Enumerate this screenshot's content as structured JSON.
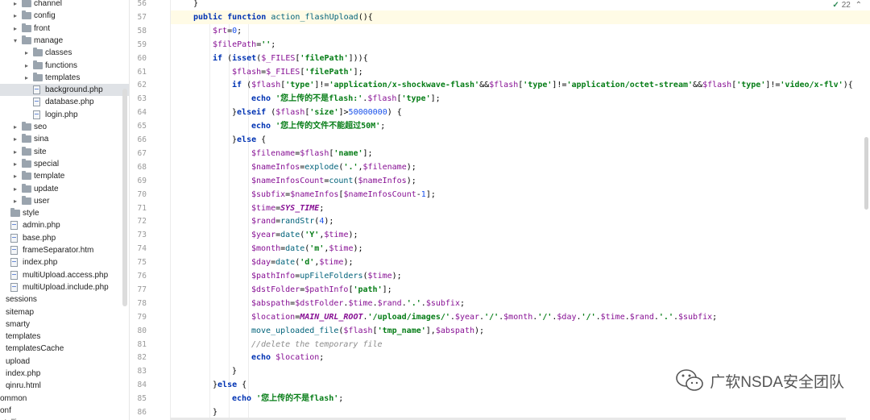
{
  "tree": {
    "items": [
      {
        "label": "channel",
        "kind": "folder",
        "indent": 1,
        "arrow": "▸"
      },
      {
        "label": "config",
        "kind": "folder",
        "indent": 1,
        "arrow": "▸"
      },
      {
        "label": "front",
        "kind": "folder",
        "indent": 1,
        "arrow": "▸"
      },
      {
        "label": "manage",
        "kind": "folder",
        "indent": 1,
        "arrow": "▾"
      },
      {
        "label": "classes",
        "kind": "folder",
        "indent": 2,
        "arrow": "▸"
      },
      {
        "label": "functions",
        "kind": "folder",
        "indent": 2,
        "arrow": "▸"
      },
      {
        "label": "templates",
        "kind": "folder",
        "indent": 2,
        "arrow": "▸"
      },
      {
        "label": "background.php",
        "kind": "file",
        "indent": 2,
        "arrow": "",
        "selected": true
      },
      {
        "label": "database.php",
        "kind": "file",
        "indent": 2,
        "arrow": ""
      },
      {
        "label": "login.php",
        "kind": "file",
        "indent": 2,
        "arrow": ""
      },
      {
        "label": "seo",
        "kind": "folder",
        "indent": 1,
        "arrow": "▸"
      },
      {
        "label": "sina",
        "kind": "folder",
        "indent": 1,
        "arrow": "▸"
      },
      {
        "label": "site",
        "kind": "folder",
        "indent": 1,
        "arrow": "▸"
      },
      {
        "label": "special",
        "kind": "folder",
        "indent": 1,
        "arrow": "▸"
      },
      {
        "label": "template",
        "kind": "folder",
        "indent": 1,
        "arrow": "▸"
      },
      {
        "label": "update",
        "kind": "folder",
        "indent": 1,
        "arrow": "▸"
      },
      {
        "label": "user",
        "kind": "folder",
        "indent": 1,
        "arrow": "▸"
      },
      {
        "label": "style",
        "kind": "folder",
        "indent": 0,
        "arrow": ""
      },
      {
        "label": "admin.php",
        "kind": "file",
        "indent": 0,
        "arrow": ""
      },
      {
        "label": "base.php",
        "kind": "file",
        "indent": 0,
        "arrow": ""
      },
      {
        "label": "frameSeparator.htm",
        "kind": "file",
        "indent": 0,
        "arrow": ""
      },
      {
        "label": "index.php",
        "kind": "file",
        "indent": 0,
        "arrow": ""
      },
      {
        "label": "multiUpload.access.php",
        "kind": "file",
        "indent": 0,
        "arrow": ""
      },
      {
        "label": "multiUpload.include.php",
        "kind": "file",
        "indent": 0,
        "arrow": ""
      },
      {
        "label": "sessions",
        "kind": "text",
        "indent": -1,
        "arrow": ""
      },
      {
        "label": "sitemap",
        "kind": "text",
        "indent": -1,
        "arrow": ""
      },
      {
        "label": "smarty",
        "kind": "text",
        "indent": -1,
        "arrow": ""
      },
      {
        "label": "templates",
        "kind": "text",
        "indent": -1,
        "arrow": ""
      },
      {
        "label": "templatesCache",
        "kind": "text",
        "indent": -1,
        "arrow": ""
      },
      {
        "label": "upload",
        "kind": "text",
        "indent": -1,
        "arrow": ""
      },
      {
        "label": "index.php",
        "kind": "text",
        "indent": -1,
        "arrow": ""
      },
      {
        "label": "qinru.html",
        "kind": "text",
        "indent": -1,
        "arrow": ""
      },
      {
        "label": "ommon",
        "kind": "text",
        "indent": -2,
        "arrow": ""
      },
      {
        "label": "onf",
        "kind": "text",
        "indent": -2,
        "arrow": ""
      },
      {
        "label": "ntellig",
        "kind": "text",
        "indent": -2,
        "arrow": ""
      }
    ]
  },
  "editor": {
    "inspection_count": "22",
    "lines": [
      {
        "n": "56",
        "i": 0,
        "t": [
          [
            "p",
            "}"
          ]
        ]
      },
      {
        "n": "57",
        "i": 0,
        "t": [
          [
            "kw",
            "public function "
          ],
          [
            "fn",
            "action_flashUpload"
          ],
          [
            "p",
            "(){"
          ]
        ]
      },
      {
        "n": "58",
        "i": 1,
        "t": [
          [
            "var",
            "$rt"
          ],
          [
            "p",
            "="
          ],
          [
            "num",
            "0"
          ],
          [
            "p",
            ";"
          ]
        ]
      },
      {
        "n": "59",
        "i": 1,
        "t": [
          [
            "var",
            "$filePath"
          ],
          [
            "p",
            "="
          ],
          [
            "str",
            "''"
          ],
          [
            "p",
            ";"
          ]
        ]
      },
      {
        "n": "60",
        "i": 1,
        "t": [
          [
            "kw",
            "if "
          ],
          [
            "p",
            "("
          ],
          [
            "kw",
            "isset"
          ],
          [
            "p",
            "("
          ],
          [
            "var",
            "$_FILES"
          ],
          [
            "p",
            "["
          ],
          [
            "str",
            "'filePath'"
          ],
          [
            "p",
            "])){"
          ]
        ]
      },
      {
        "n": "61",
        "i": 2,
        "t": [
          [
            "var",
            "$flash"
          ],
          [
            "p",
            "="
          ],
          [
            "var",
            "$_FILES"
          ],
          [
            "p",
            "["
          ],
          [
            "str",
            "'filePath'"
          ],
          [
            "p",
            "];"
          ]
        ]
      },
      {
        "n": "62",
        "i": 2,
        "t": [
          [
            "kw",
            "if "
          ],
          [
            "p",
            "("
          ],
          [
            "var",
            "$flash"
          ],
          [
            "p",
            "["
          ],
          [
            "str",
            "'type'"
          ],
          [
            "p",
            "]!="
          ],
          [
            "str",
            "'application/x-shockwave-flash'"
          ],
          [
            "p",
            "&&"
          ],
          [
            "var",
            "$flash"
          ],
          [
            "p",
            "["
          ],
          [
            "str",
            "'type'"
          ],
          [
            "p",
            "]!="
          ],
          [
            "str",
            "'application/octet-stream'"
          ],
          [
            "p",
            "&&"
          ],
          [
            "var",
            "$flash"
          ],
          [
            "p",
            "["
          ],
          [
            "str",
            "'type'"
          ],
          [
            "p",
            "]!="
          ],
          [
            "str",
            "'video/x-flv'"
          ],
          [
            "p",
            "){"
          ]
        ]
      },
      {
        "n": "63",
        "i": 3,
        "t": [
          [
            "kw",
            "echo "
          ],
          [
            "str",
            "'您上传的不是flash:'"
          ],
          [
            "p",
            "."
          ],
          [
            "var",
            "$flash"
          ],
          [
            "p",
            "["
          ],
          [
            "str",
            "'type'"
          ],
          [
            "p",
            "];"
          ]
        ]
      },
      {
        "n": "64",
        "i": 2,
        "t": [
          [
            "p",
            "}"
          ],
          [
            "kw",
            "elseif "
          ],
          [
            "p",
            "("
          ],
          [
            "var",
            "$flash"
          ],
          [
            "p",
            "["
          ],
          [
            "str",
            "'size'"
          ],
          [
            "p",
            "]>"
          ],
          [
            "num",
            "50000000"
          ],
          [
            "p",
            ") {"
          ]
        ]
      },
      {
        "n": "65",
        "i": 3,
        "t": [
          [
            "kw",
            "echo "
          ],
          [
            "str",
            "'您上传的文件不能超过50M'"
          ],
          [
            "p",
            ";"
          ]
        ]
      },
      {
        "n": "66",
        "i": 2,
        "t": [
          [
            "p",
            "}"
          ],
          [
            "kw",
            "else "
          ],
          [
            "p",
            "{"
          ]
        ]
      },
      {
        "n": "67",
        "i": 3,
        "t": [
          [
            "var",
            "$filename"
          ],
          [
            "p",
            "="
          ],
          [
            "var",
            "$flash"
          ],
          [
            "p",
            "["
          ],
          [
            "str",
            "'name'"
          ],
          [
            "p",
            "];"
          ]
        ]
      },
      {
        "n": "68",
        "i": 3,
        "t": [
          [
            "var",
            "$nameInfos"
          ],
          [
            "p",
            "="
          ],
          [
            "fn",
            "explode"
          ],
          [
            "p",
            "("
          ],
          [
            "str",
            "'.'"
          ],
          [
            "p",
            ","
          ],
          [
            "var",
            "$filename"
          ],
          [
            "p",
            ");"
          ]
        ]
      },
      {
        "n": "69",
        "i": 3,
        "t": [
          [
            "var",
            "$nameInfosCount"
          ],
          [
            "p",
            "="
          ],
          [
            "fn",
            "count"
          ],
          [
            "p",
            "("
          ],
          [
            "var",
            "$nameInfos"
          ],
          [
            "p",
            ");"
          ]
        ]
      },
      {
        "n": "70",
        "i": 3,
        "t": [
          [
            "var",
            "$subfix"
          ],
          [
            "p",
            "="
          ],
          [
            "var",
            "$nameInfos"
          ],
          [
            "p",
            "["
          ],
          [
            "var",
            "$nameInfosCount"
          ],
          [
            "p",
            "-"
          ],
          [
            "num",
            "1"
          ],
          [
            "p",
            "];"
          ]
        ]
      },
      {
        "n": "71",
        "i": 3,
        "t": [
          [
            "var",
            "$time"
          ],
          [
            "p",
            "="
          ],
          [
            "cst",
            "SYS_TIME"
          ],
          [
            "p",
            ";"
          ]
        ]
      },
      {
        "n": "72",
        "i": 3,
        "t": [
          [
            "var",
            "$rand"
          ],
          [
            "p",
            "="
          ],
          [
            "fn",
            "randStr"
          ],
          [
            "p",
            "("
          ],
          [
            "num",
            "4"
          ],
          [
            "p",
            ");"
          ]
        ]
      },
      {
        "n": "73",
        "i": 3,
        "t": [
          [
            "var",
            "$year"
          ],
          [
            "p",
            "="
          ],
          [
            "fn",
            "date"
          ],
          [
            "p",
            "("
          ],
          [
            "str",
            "'Y'"
          ],
          [
            "p",
            ","
          ],
          [
            "var",
            "$time"
          ],
          [
            "p",
            ");"
          ]
        ]
      },
      {
        "n": "74",
        "i": 3,
        "t": [
          [
            "var",
            "$month"
          ],
          [
            "p",
            "="
          ],
          [
            "fn",
            "date"
          ],
          [
            "p",
            "("
          ],
          [
            "str",
            "'m'"
          ],
          [
            "p",
            ","
          ],
          [
            "var",
            "$time"
          ],
          [
            "p",
            ");"
          ]
        ]
      },
      {
        "n": "75",
        "i": 3,
        "t": [
          [
            "var",
            "$day"
          ],
          [
            "p",
            "="
          ],
          [
            "fn",
            "date"
          ],
          [
            "p",
            "("
          ],
          [
            "str",
            "'d'"
          ],
          [
            "p",
            ","
          ],
          [
            "var",
            "$time"
          ],
          [
            "p",
            ");"
          ]
        ]
      },
      {
        "n": "76",
        "i": 3,
        "t": [
          [
            "var",
            "$pathInfo"
          ],
          [
            "p",
            "="
          ],
          [
            "fn",
            "upFileFolders"
          ],
          [
            "p",
            "("
          ],
          [
            "var",
            "$time"
          ],
          [
            "p",
            ");"
          ]
        ]
      },
      {
        "n": "77",
        "i": 3,
        "t": [
          [
            "var",
            "$dstFolder"
          ],
          [
            "p",
            "="
          ],
          [
            "var",
            "$pathInfo"
          ],
          [
            "p",
            "["
          ],
          [
            "str",
            "'path'"
          ],
          [
            "p",
            "];"
          ]
        ]
      },
      {
        "n": "78",
        "i": 3,
        "t": [
          [
            "var",
            "$abspath"
          ],
          [
            "p",
            "="
          ],
          [
            "var",
            "$dstFolder"
          ],
          [
            "p",
            "."
          ],
          [
            "var",
            "$time"
          ],
          [
            "p",
            "."
          ],
          [
            "var",
            "$rand"
          ],
          [
            "p",
            "."
          ],
          [
            "str",
            "'.'"
          ],
          [
            "p",
            "."
          ],
          [
            "var",
            "$subfix"
          ],
          [
            "p",
            ";"
          ]
        ]
      },
      {
        "n": "79",
        "i": 3,
        "t": [
          [
            "var",
            "$location"
          ],
          [
            "p",
            "="
          ],
          [
            "cst",
            "MAIN_URL_ROOT"
          ],
          [
            "p",
            "."
          ],
          [
            "str",
            "'/upload/images/'"
          ],
          [
            "p",
            "."
          ],
          [
            "var",
            "$year"
          ],
          [
            "p",
            "."
          ],
          [
            "str",
            "'/'"
          ],
          [
            "p",
            "."
          ],
          [
            "var",
            "$month"
          ],
          [
            "p",
            "."
          ],
          [
            "str",
            "'/'"
          ],
          [
            "p",
            "."
          ],
          [
            "var",
            "$day"
          ],
          [
            "p",
            "."
          ],
          [
            "str",
            "'/'"
          ],
          [
            "p",
            "."
          ],
          [
            "var",
            "$time"
          ],
          [
            "p",
            "."
          ],
          [
            "var",
            "$rand"
          ],
          [
            "p",
            "."
          ],
          [
            "str",
            "'.'"
          ],
          [
            "p",
            "."
          ],
          [
            "var",
            "$subfix"
          ],
          [
            "p",
            ";"
          ]
        ]
      },
      {
        "n": "80",
        "i": 3,
        "t": [
          [
            "fn",
            "move_uploaded_file"
          ],
          [
            "p",
            "("
          ],
          [
            "var",
            "$flash"
          ],
          [
            "p",
            "["
          ],
          [
            "str",
            "'tmp_name'"
          ],
          [
            "p",
            "],"
          ],
          [
            "var",
            "$abspath"
          ],
          [
            "p",
            ");"
          ]
        ]
      },
      {
        "n": "81",
        "i": 3,
        "t": [
          [
            "cmt",
            "//delete the temporary file"
          ]
        ]
      },
      {
        "n": "82",
        "i": 3,
        "t": [
          [
            "kw",
            "echo "
          ],
          [
            "var",
            "$location"
          ],
          [
            "p",
            ";"
          ]
        ]
      },
      {
        "n": "83",
        "i": 2,
        "t": [
          [
            "p",
            "}"
          ]
        ]
      },
      {
        "n": "84",
        "i": 1,
        "t": [
          [
            "p",
            "}"
          ],
          [
            "kw",
            "else "
          ],
          [
            "p",
            "{"
          ]
        ]
      },
      {
        "n": "85",
        "i": 2,
        "t": [
          [
            "kw",
            "echo "
          ],
          [
            "str",
            "'您上传的不是flash'"
          ],
          [
            "p",
            ";"
          ]
        ]
      },
      {
        "n": "86",
        "i": 1,
        "t": [
          [
            "p",
            "}"
          ]
        ]
      }
    ]
  },
  "watermark": {
    "text": "广软NSDA安全团队"
  },
  "colors": {
    "keyword": "#0033b3",
    "string": "#067d17",
    "variable": "#871094",
    "number": "#1750eb",
    "comment": "#8c8c8c",
    "function": "#00627a",
    "selection": "#dfe2e6"
  },
  "icons": {
    "tree_folder": "folder-icon",
    "tree_file": "php-file-icon",
    "inspection": "check-icon",
    "watermark": "wechat-icon"
  }
}
